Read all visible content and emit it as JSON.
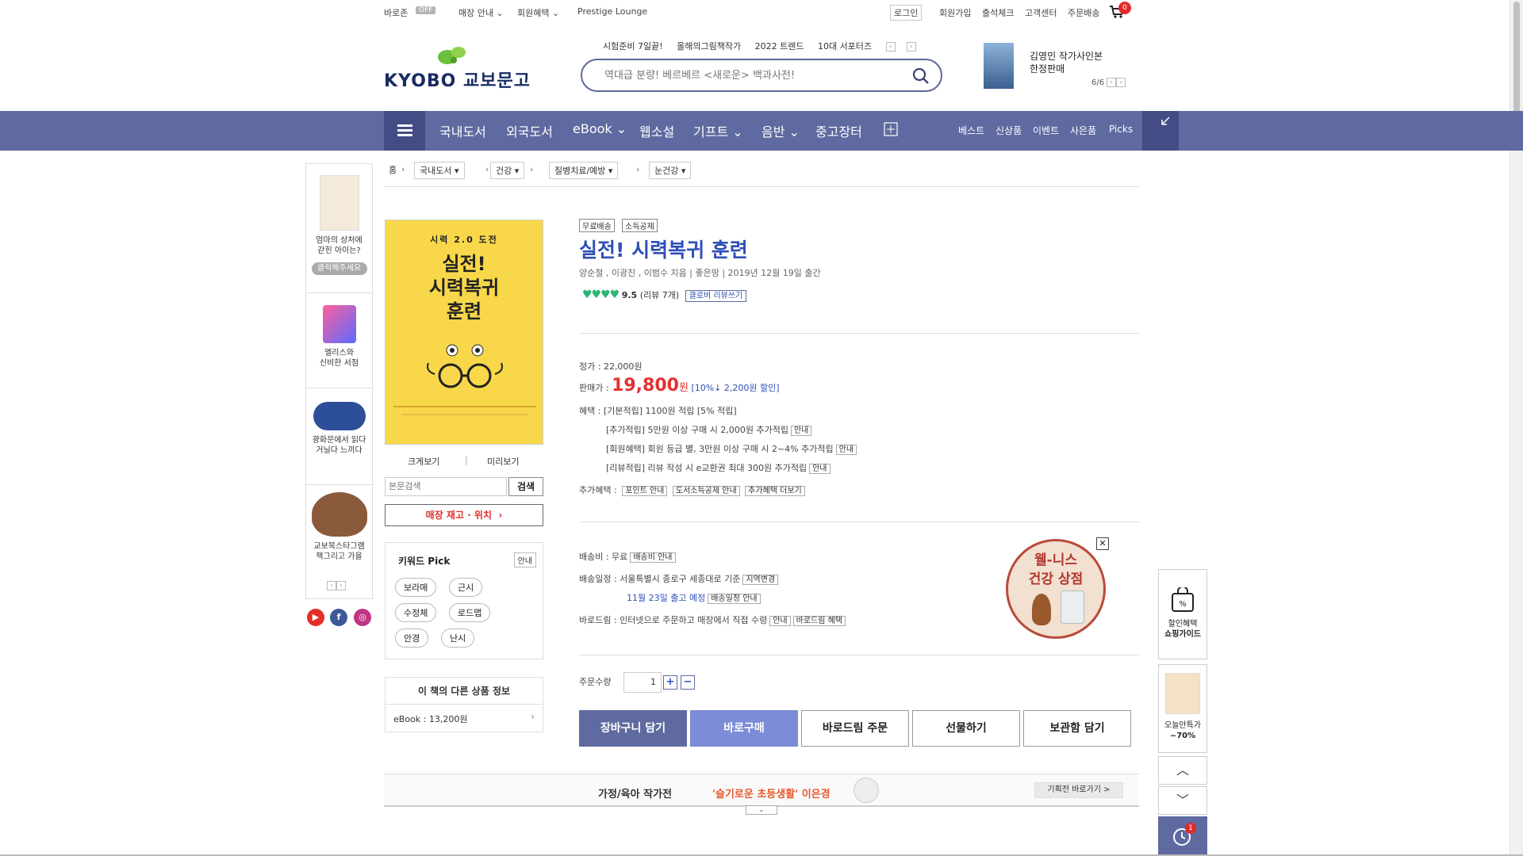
{
  "util": {
    "baro": "바로존",
    "baro_status": "OFF",
    "store_info": "매장 안내",
    "member_benefit": "회원혜택",
    "prestige": "Prestige Lounge",
    "login": "로그인",
    "join": "회원가입",
    "attendance": "출석체크",
    "customer": "고객센터",
    "order": "주문배송",
    "cart_count": "0"
  },
  "logo": {
    "text": "KYOBO 교보문고"
  },
  "search": {
    "keywords": [
      "시험준비 7일끝!",
      "올해의그림책작가",
      "2022 트렌드",
      "10대 서포터즈"
    ],
    "placeholder": "역대급 분량! 베르베르 <새로운> 백과사전!"
  },
  "promo": {
    "title_line1": "김영민 작가사인본",
    "title_line2": "한정판매",
    "page": "6/6"
  },
  "nav": {
    "categories": [
      "국내도서",
      "외국도서",
      "eBook",
      "웹소설",
      "기프트",
      "음반",
      "중고장터"
    ],
    "right": [
      "베스트",
      "신상품",
      "이벤트",
      "사은품",
      "Picks"
    ]
  },
  "left_banner": {
    "items": [
      {
        "label1": "엄마의 상처에",
        "label2": "갇힌 아이는?",
        "button": "클릭해주세요"
      },
      {
        "label1": "엘리스와",
        "label2": "신비한 서점"
      },
      {
        "label1": "광화문에서 읽다",
        "label2": "거닐다 느끼다"
      },
      {
        "label1": "교보북스타그램",
        "label2": "책그리고 가을"
      }
    ]
  },
  "breadcrumb": {
    "home": "홈",
    "items": [
      "국내도서",
      "건강",
      "질병치료/예방",
      "눈건강"
    ]
  },
  "cover": {
    "series": "시력 2.0 도전",
    "title1": "실전!",
    "title2": "시력복귀",
    "title3": "훈련"
  },
  "cover_links": {
    "zoom": "크게보기",
    "preview": "미리보기"
  },
  "inner_search": {
    "placeholder": "본문검색",
    "button": "검색"
  },
  "stock_button": "매장 재고 · 위치",
  "keyword_pick": {
    "title": "키워드 Pick",
    "info": "안내",
    "tags": [
      "보라매",
      "근시",
      "수정체",
      "로드맵",
      "안경",
      "난시"
    ]
  },
  "other_info": {
    "title": "이 책의 다른 상품 정보",
    "ebook": "eBook : 13,200원"
  },
  "book": {
    "badges": [
      "무료배송",
      "소득공제"
    ],
    "title": "실전! 시력복귀 훈련",
    "authors": "양순철 , 이광진 , 이범수 지음 | 좋은땅 | 2019년 12월 19일 출간",
    "rating_score": "9.5",
    "rating_count": "(리뷰 7개)",
    "review_button": "클로버 리뷰쓰기"
  },
  "pricing": {
    "list_label": "정가 : 22,000원",
    "sale_label": "판매가 :",
    "sale_price": "19,800",
    "won": "원",
    "discount": "[10%↓ 2,200원 할인]",
    "benefit_label": "혜택 :",
    "benefit_main": "[기본적립] 1100원 적립 [5% 적립]",
    "benefit_extra": "[추가적립] 5만원 이상 구매 시 2,000원 추가적립",
    "benefit_member": "[회원혜택] 회원 등급 별, 3만원 이상 구매 시 2~4% 추가적립",
    "benefit_review": "[리뷰적립] 리뷰 작성 시 e교환권 최대 300원 추가적립",
    "info": "안내",
    "additional_label": "추가혜택 :",
    "additional": [
      "포인트 안내",
      "도서소득공제 안내",
      "추가혜택 더보기"
    ]
  },
  "shipping": {
    "fee": "배송비 : 무료",
    "fee_info": "배송비 안내",
    "schedule": "배송일정 : 서울특별시 종로구 세종대로 기준",
    "region_change": "지역변경",
    "expected": "11월 23일 출고 예정",
    "schedule_info": "배송일정 안내",
    "barodream": "바로드림 : 인터넷으로 주문하고 매장에서 직접 수령",
    "info": "안내",
    "barodream_benefit": "바로드림 혜택"
  },
  "wellness": {
    "line1": "웰-니스",
    "line2": "건강 상점"
  },
  "order": {
    "qty_label": "주문수량",
    "qty": "1",
    "plus": "+",
    "minus": "−",
    "buttons": [
      "장바구니 담기",
      "바로구매",
      "바로드림 주문",
      "선물하기",
      "보관함 담기"
    ]
  },
  "footer_promo": {
    "category": "가정/육아 작가전",
    "highlight": "'슬기로운 초등생활' 이은경",
    "button": "기획전 바로가기 >"
  },
  "right_quick": {
    "guide1": "할인혜택",
    "guide2": "쇼핑가이드",
    "deal1": "오늘만특가",
    "deal2": "~70%",
    "recent_count": "1"
  },
  "colors": {
    "accent": "#5f6aa0",
    "title": "#2f4fb6",
    "price": "#e3302f"
  }
}
